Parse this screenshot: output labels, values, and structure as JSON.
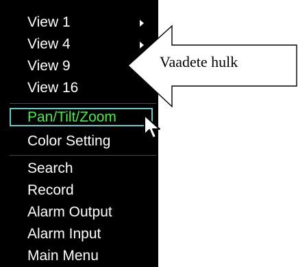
{
  "menu": {
    "items": [
      {
        "label": "View 1",
        "has_submenu": true
      },
      {
        "label": "View 4",
        "has_submenu": true
      },
      {
        "label": "View 9",
        "has_submenu": false
      },
      {
        "label": "View 16",
        "has_submenu": false
      },
      {
        "label": "Pan/Tilt/Zoom",
        "selected": true
      },
      {
        "label": "Color Setting"
      },
      {
        "label": "Search"
      },
      {
        "label": "Record"
      },
      {
        "label": "Alarm Output"
      },
      {
        "label": "Alarm Input"
      },
      {
        "label": "Main Menu"
      }
    ]
  },
  "annotation": {
    "text": "Vaadete hulk"
  },
  "colors": {
    "menu_background": "#000000",
    "menu_text": "#ffffff",
    "selected_text": "#41f041",
    "selection_border": "#62cfcf"
  },
  "icons": {
    "submenu": "chevron-right-icon",
    "pointer": "mouse-cursor-icon",
    "callout": "left-arrow-callout"
  }
}
